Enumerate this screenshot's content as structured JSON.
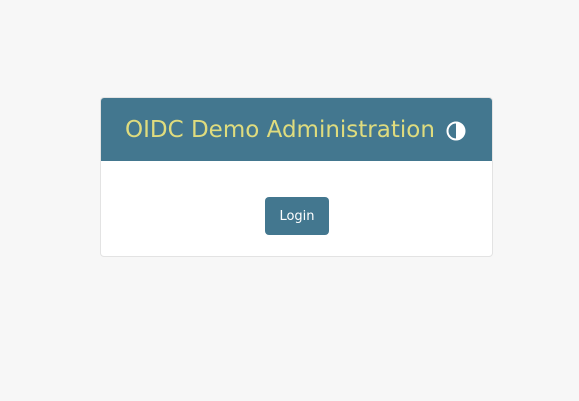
{
  "card": {
    "title": "OIDC Demo Administration",
    "theme_toggle_icon": "contrast-icon"
  },
  "login": {
    "label": "Login"
  },
  "colors": {
    "page_background": "#f7f7f7",
    "header_background": "#43778f",
    "title_text": "#dfdc7e",
    "button_background": "#43778f",
    "button_text": "#ffffff"
  }
}
